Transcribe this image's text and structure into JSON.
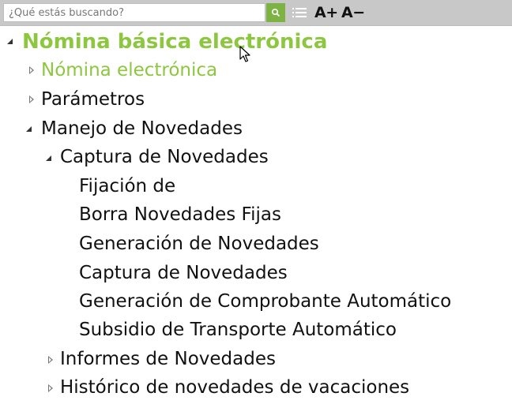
{
  "toolbar": {
    "search_placeholder": "¿Qué estás buscando?",
    "font_increase_label": "A+",
    "font_decrease_label": "A−",
    "accent_color": "#8dc63f",
    "icons": [
      "search-icon",
      "list-icon"
    ]
  },
  "tree": {
    "root": {
      "label": "Nómina básica electrónica",
      "expanded": true
    },
    "items": {
      "nomina_electronica": {
        "label": "Nómina electrónica",
        "expanded": false
      },
      "parametros": {
        "label": "Parámetros",
        "expanded": false
      },
      "manejo_novedades": {
        "label": "Manejo de Novedades",
        "expanded": true
      },
      "captura_novedades_group": {
        "label": "Captura de Novedades",
        "expanded": true
      },
      "fijacion": {
        "label": "Fijación de"
      },
      "borra_fijas": {
        "label": "Borra Novedades Fijas"
      },
      "generacion_novedades": {
        "label": "Generación de Novedades"
      },
      "captura_novedades": {
        "label": "Captura de Novedades"
      },
      "generacion_comprobante": {
        "label": "Generación de Comprobante Automático"
      },
      "subsidio_transporte": {
        "label": "Subsidio de Transporte Automático"
      },
      "informes_novedades": {
        "label": "Informes de Novedades",
        "expanded": false
      },
      "historico_vacaciones": {
        "label": "Histórico de novedades de vacaciones",
        "expanded": false
      }
    }
  }
}
